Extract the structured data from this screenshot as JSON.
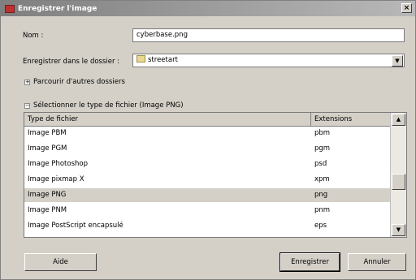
{
  "window": {
    "title": "Enregistrer l'image",
    "close_label": "×"
  },
  "form": {
    "name_label": "Nom :",
    "name_value": "cyberbase.png",
    "folder_label": "Enregistrer dans le dossier :",
    "folder_value": "streetart"
  },
  "expanders": {
    "browse": {
      "toggle": "+",
      "label": "Parcourir d'autres dossiers"
    },
    "filetype": {
      "toggle": "−",
      "label": "Sélectionner le type de fichier (Image PNG)"
    }
  },
  "filetypes": {
    "columns": [
      "Type de fichier",
      "Extensions"
    ],
    "rows": [
      {
        "type": "Image PBM",
        "ext": "pbm"
      },
      {
        "type": "Image PGM",
        "ext": "pgm"
      },
      {
        "type": "Image Photoshop",
        "ext": "psd"
      },
      {
        "type": "Image pixmap X",
        "ext": "xpm"
      },
      {
        "type": "Image PNG",
        "ext": "png"
      },
      {
        "type": "Image PNM",
        "ext": "pnm"
      },
      {
        "type": "Image PostScript encapsulé",
        "ext": "eps"
      }
    ],
    "selected_index": 4
  },
  "buttons": {
    "help": "Aide",
    "save": "Enregistrer",
    "cancel": "Annuler"
  },
  "icons": {
    "arrow_down": "▼",
    "arrow_up": "▲"
  }
}
